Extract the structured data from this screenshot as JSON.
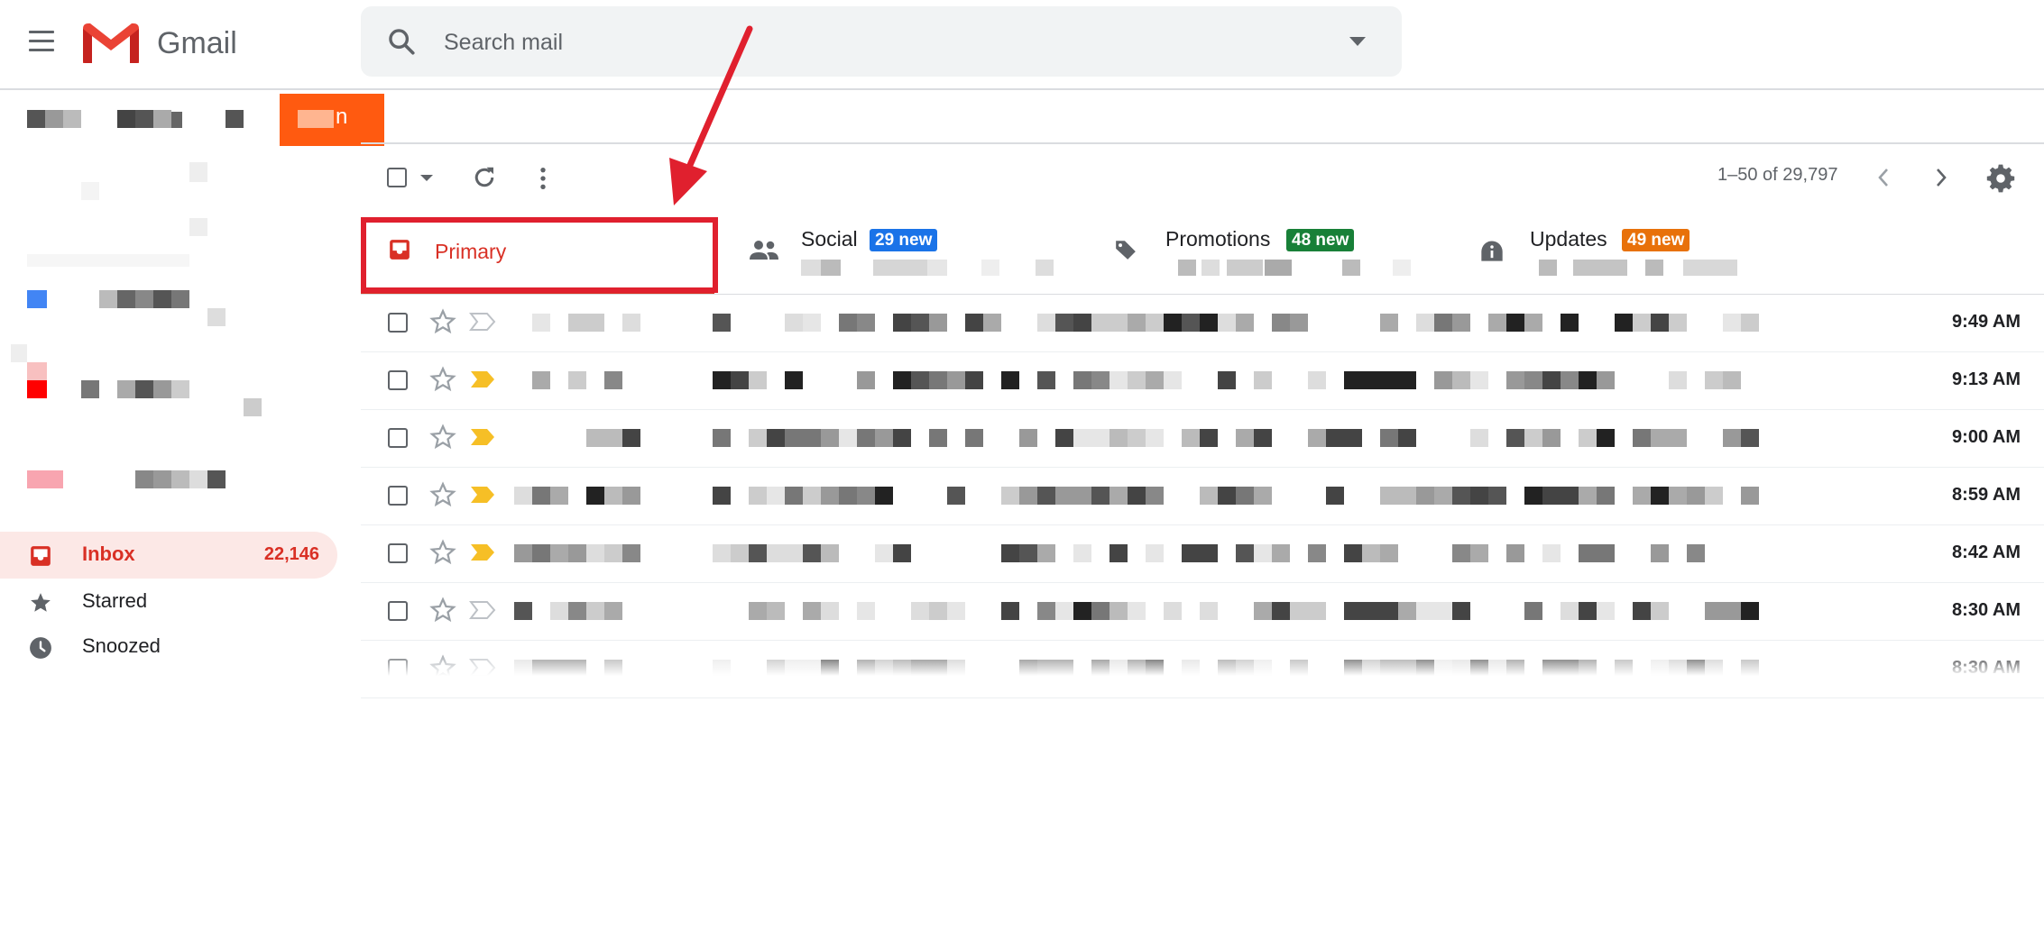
{
  "header": {
    "menu_icon": "hamburger-menu-icon",
    "brand": "Gmail",
    "brand_colors": {
      "red": "#EA4335",
      "dark_red": "#C5221F",
      "blue": "#4285F4",
      "green": "#34A853",
      "yellow": "#FBBC04"
    },
    "search": {
      "placeholder": "Search mail",
      "value": ""
    }
  },
  "sidebar": {
    "items": [
      {
        "label": "Inbox",
        "count": "22,146",
        "icon": "inbox-icon",
        "active": true
      },
      {
        "label": "Starred",
        "count": "",
        "icon": "star-icon",
        "active": false
      },
      {
        "label": "Snoozed",
        "count": "",
        "icon": "clock-icon",
        "active": false
      }
    ],
    "redacted_label_colors": [
      "#4285F4",
      "#FF0000",
      "#F8A5B0"
    ]
  },
  "redacted_button_text": "n",
  "toolbar": {
    "page_info": "1–50 of 29,797",
    "icons": [
      "select-all-checkbox",
      "refresh-icon",
      "more-vert-icon",
      "chevron-left-icon",
      "chevron-right-icon",
      "gear-icon"
    ]
  },
  "tabs": [
    {
      "label": "Primary",
      "badge": "",
      "icon": "inbox-icon",
      "active": true
    },
    {
      "label": "Social",
      "badge": "29 new",
      "badge_color": "#1a73e8",
      "icon": "people-icon",
      "active": false
    },
    {
      "label": "Promotions",
      "badge": "48 new",
      "badge_color": "#188038",
      "icon": "tag-icon",
      "active": false
    },
    {
      "label": "Updates",
      "badge": "49 new",
      "badge_color": "#e8710a",
      "icon": "info-icon",
      "active": false
    }
  ],
  "emails": [
    {
      "time": "9:49 AM",
      "important": false
    },
    {
      "time": "9:13 AM",
      "important": true
    },
    {
      "time": "9:00 AM",
      "important": true
    },
    {
      "time": "8:59 AM",
      "important": true
    },
    {
      "time": "8:42 AM",
      "important": true
    },
    {
      "time": "8:30 AM",
      "important": false
    },
    {
      "time": "8:30 AM",
      "important": false
    }
  ],
  "annotation": {
    "arrow_color": "#e0202e",
    "highlight": "Primary tab"
  }
}
